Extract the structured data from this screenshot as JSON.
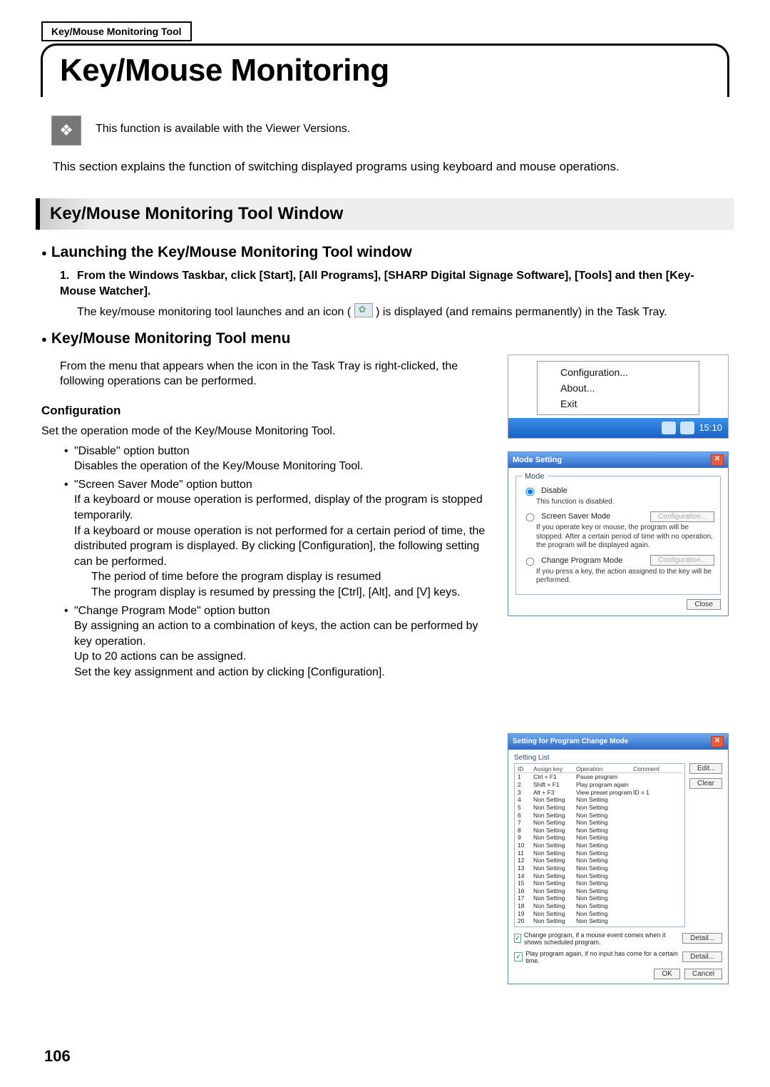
{
  "header_tab": "Key/Mouse Monitoring Tool",
  "title": "Key/Mouse Monitoring",
  "intro_note": "This function is available with the Viewer Versions.",
  "section_explain": "This section explains the function of switching displayed programs using keyboard and mouse operations.",
  "h2": "Key/Mouse Monitoring Tool Window",
  "h3_launch": "Launching the Key/Mouse Monitoring Tool window",
  "step1": "From the Windows Taskbar, click [Start], [All Programs], [SHARP Digital Signage Software], [Tools] and then [Key-Mouse Watcher].",
  "step1_detail_a": "The key/mouse monitoring tool launches and an icon (",
  "step1_detail_b": ") is displayed (and remains permanently) in the Task Tray.",
  "h3_menu": "Key/Mouse Monitoring Tool menu",
  "menu_intro": "From the menu that appears when the icon in the Task Tray is right-clicked, the following operations can be performed.",
  "h4_config": "Configuration",
  "config_para": "Set the operation mode of the Key/Mouse Monitoring Tool.",
  "bullets": {
    "disable_title": "\"Disable\" option button",
    "disable_desc": "Disables the operation of the Key/Mouse Monitoring Tool.",
    "ssm_title": "\"Screen Saver Mode\" option button",
    "ssm_desc1": "If a keyboard or mouse operation is performed, display of the program is stopped temporarily.",
    "ssm_desc2": "If a keyboard or mouse operation is not performed for a certain period of time, the distributed program is displayed. By clicking [Configuration], the following setting can be performed.",
    "ssm_sub1": "The period of time before the program display is resumed",
    "ssm_sub2": "The program display is resumed by pressing the [Ctrl], [Alt], and [V] keys.",
    "cpm_title": "\"Change Program Mode\" option button",
    "cpm_desc1": "By assigning an action to a combination of keys, the action can be performed by key operation.",
    "cpm_desc2": "Up to 20 actions can be assigned.",
    "cpm_desc3": "Set the key assignment and action by clicking [Configuration]."
  },
  "ctx_menu": {
    "items": [
      "Configuration...",
      "About...",
      "Exit"
    ],
    "clock": "15:10"
  },
  "mode_setting": {
    "title": "Mode Setting",
    "legend": "Mode",
    "opt_disable": "Disable",
    "opt_disable_desc": "This function is disabled.",
    "opt_ssm": "Screen Saver Mode",
    "opt_ssm_desc": "If you operate key or mouse, the program will be stopped. After a certain period of time with no operation, the program will be displayed again.",
    "opt_cpm": "Change Program Mode",
    "opt_cpm_desc": "If you press a key, the action assigned to the key will be performed.",
    "config_btn": "Configuration...",
    "close_btn": "Close"
  },
  "chart_data": {
    "type": "table",
    "title": "Setting for Program Change Mode",
    "columns": [
      "ID",
      "Assign key",
      "Operation",
      "Comment"
    ],
    "rows": [
      [
        "1",
        "Ctrl + F1",
        "Pause program",
        ""
      ],
      [
        "2",
        "Shift + F1",
        "Play program again",
        ""
      ],
      [
        "3",
        "Alt + F3",
        "View preset program",
        "ID = 1"
      ],
      [
        "4",
        "Non Setting",
        "Non Setting",
        ""
      ],
      [
        "5",
        "Non Setting",
        "Non Setting",
        ""
      ],
      [
        "6",
        "Non Setting",
        "Non Setting",
        ""
      ],
      [
        "7",
        "Non Setting",
        "Non Setting",
        ""
      ],
      [
        "8",
        "Non Setting",
        "Non Setting",
        ""
      ],
      [
        "9",
        "Non Setting",
        "Non Setting",
        ""
      ],
      [
        "10",
        "Non Setting",
        "Non Setting",
        ""
      ],
      [
        "11",
        "Non Setting",
        "Non Setting",
        ""
      ],
      [
        "12",
        "Non Setting",
        "Non Setting",
        ""
      ],
      [
        "13",
        "Non Setting",
        "Non Setting",
        ""
      ],
      [
        "14",
        "Non Setting",
        "Non Setting",
        ""
      ],
      [
        "15",
        "Non Setting",
        "Non Setting",
        ""
      ],
      [
        "16",
        "Non Setting",
        "Non Setting",
        ""
      ],
      [
        "17",
        "Non Setting",
        "Non Setting",
        ""
      ],
      [
        "18",
        "Non Setting",
        "Non Setting",
        ""
      ],
      [
        "19",
        "Non Setting",
        "Non Setting",
        ""
      ],
      [
        "20",
        "Non Setting",
        "Non Setting",
        ""
      ]
    ]
  },
  "change_mode": {
    "title": "Setting for Program Change Mode",
    "setting_list": "Setting List",
    "edit_btn": "Edit...",
    "clear_btn": "Clear",
    "detail_btn": "Detail...",
    "ok_btn": "OK",
    "cancel_btn": "Cancel",
    "chk1": "Change program, if a mouse event comes when it shows scheduled program.",
    "chk2": "Play program again, if no input has come for a certain time."
  },
  "page_number": "106"
}
